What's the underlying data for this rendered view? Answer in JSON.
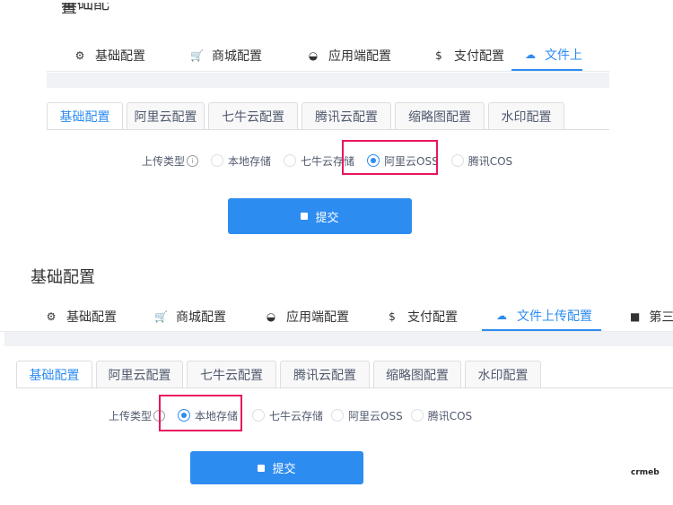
{
  "top": {
    "cut_title": "基础配置",
    "nav": [
      {
        "icon": "gear-icon",
        "glyph": "⚙",
        "label": "基础配置"
      },
      {
        "icon": "cart-icon",
        "glyph": "🛒",
        "label": "商城配置"
      },
      {
        "icon": "app-icon",
        "glyph": "◒",
        "label": "应用端配置"
      },
      {
        "icon": "dollar-icon",
        "glyph": "$",
        "label": "支付配置"
      },
      {
        "icon": "cloud-upload-icon",
        "glyph": "☁",
        "label": "文件上"
      }
    ],
    "subtabs": [
      "基础配置",
      "阿里云配置",
      "七牛云配置",
      "腾讯云配置",
      "缩略图配置",
      "水印配置"
    ],
    "upload_type_label": "上传类型",
    "radios": [
      "本地存储",
      "七牛云存储",
      "阿里云OSS",
      "腾讯COS"
    ],
    "selected": "阿里云OSS",
    "submit": "提交"
  },
  "bottom": {
    "title": "基础配置",
    "nav": [
      {
        "icon": "gear-icon",
        "glyph": "⚙",
        "label": "基础配置"
      },
      {
        "icon": "cart-icon",
        "glyph": "🛒",
        "label": "商城配置"
      },
      {
        "icon": "app-icon",
        "glyph": "◒",
        "label": "应用端配置"
      },
      {
        "icon": "dollar-icon",
        "glyph": "$",
        "label": "支付配置"
      },
      {
        "icon": "cloud-upload-icon",
        "glyph": "☁",
        "label": "文件上传配置"
      },
      {
        "icon": "bag-icon",
        "glyph": "■",
        "label": "第三"
      }
    ],
    "subtabs": [
      "基础配置",
      "阿里云配置",
      "七牛云配置",
      "腾讯云配置",
      "缩略图配置",
      "水印配置"
    ],
    "upload_type_label": "上传类型",
    "radios": [
      "本地存储",
      "七牛云存储",
      "阿里云OSS",
      "腾讯COS"
    ],
    "selected": "本地存储",
    "submit": "提交"
  },
  "watermark": "crmeb",
  "colors": {
    "accent": "#2d8cf0",
    "highlight": "#e8175d"
  }
}
